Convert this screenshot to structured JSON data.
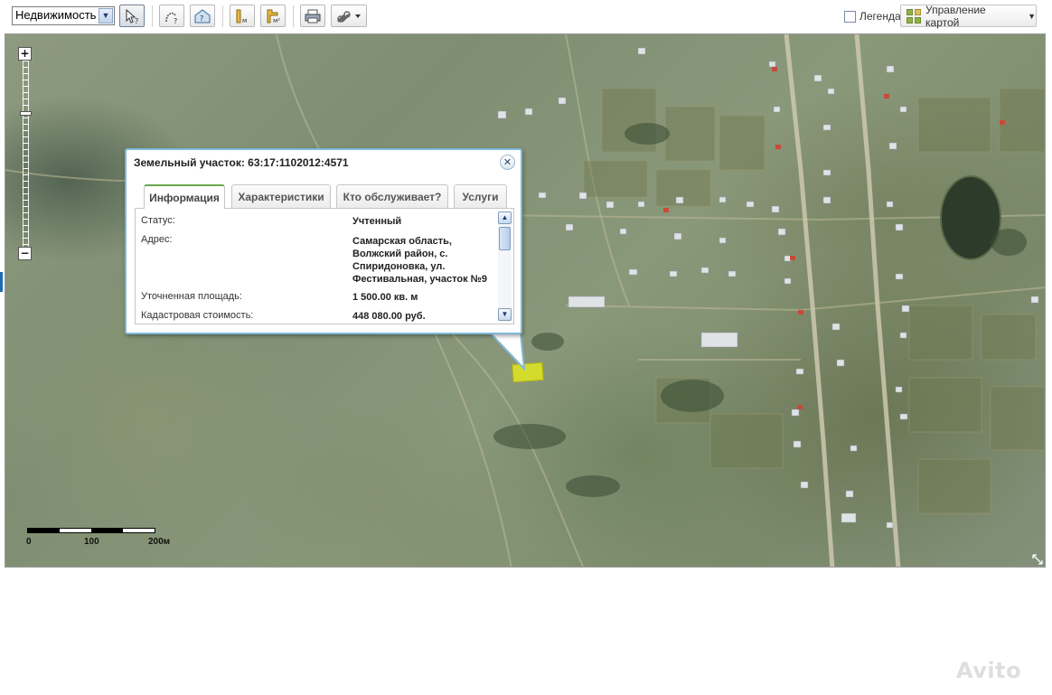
{
  "toolbar": {
    "layer_select": "Недвижимость",
    "buttons": [
      "cursor-info",
      "measure-curve",
      "house-search",
      "measure-distance",
      "measure-area",
      "print",
      "link"
    ],
    "legend_label": "Легенда",
    "map_control_label": "Управление картой"
  },
  "map": {
    "zoom_in": "+",
    "zoom_out": "−",
    "scale": {
      "labels": [
        "0",
        "100",
        "200м"
      ]
    }
  },
  "popup": {
    "title": "Земельный участок: 63:17:1102012:4571",
    "close": "✕",
    "tabs": [
      {
        "label": "Информация",
        "active": true
      },
      {
        "label": "Характеристики",
        "active": false
      },
      {
        "label": "Кто обслуживает?",
        "active": false
      },
      {
        "label": "Услуги",
        "active": false
      }
    ],
    "fields": [
      {
        "key": "Статус:",
        "value": "Учтенный"
      },
      {
        "key": "Адрес:",
        "value": "Самарская область, Волжский район, с. Спиридоновка, ул. Фестивальная, участок №9"
      },
      {
        "key": "Уточненная площадь:",
        "value": "1 500.00 кв. м"
      },
      {
        "key": "Кадастровая стоимость:",
        "value": "448 080.00 руб."
      }
    ]
  },
  "colors": {
    "popup_border": "#7fb8d8",
    "active_tab_accent": "#6aa84f",
    "parcel_fill": "#e0e81e"
  },
  "watermark": "Avito"
}
